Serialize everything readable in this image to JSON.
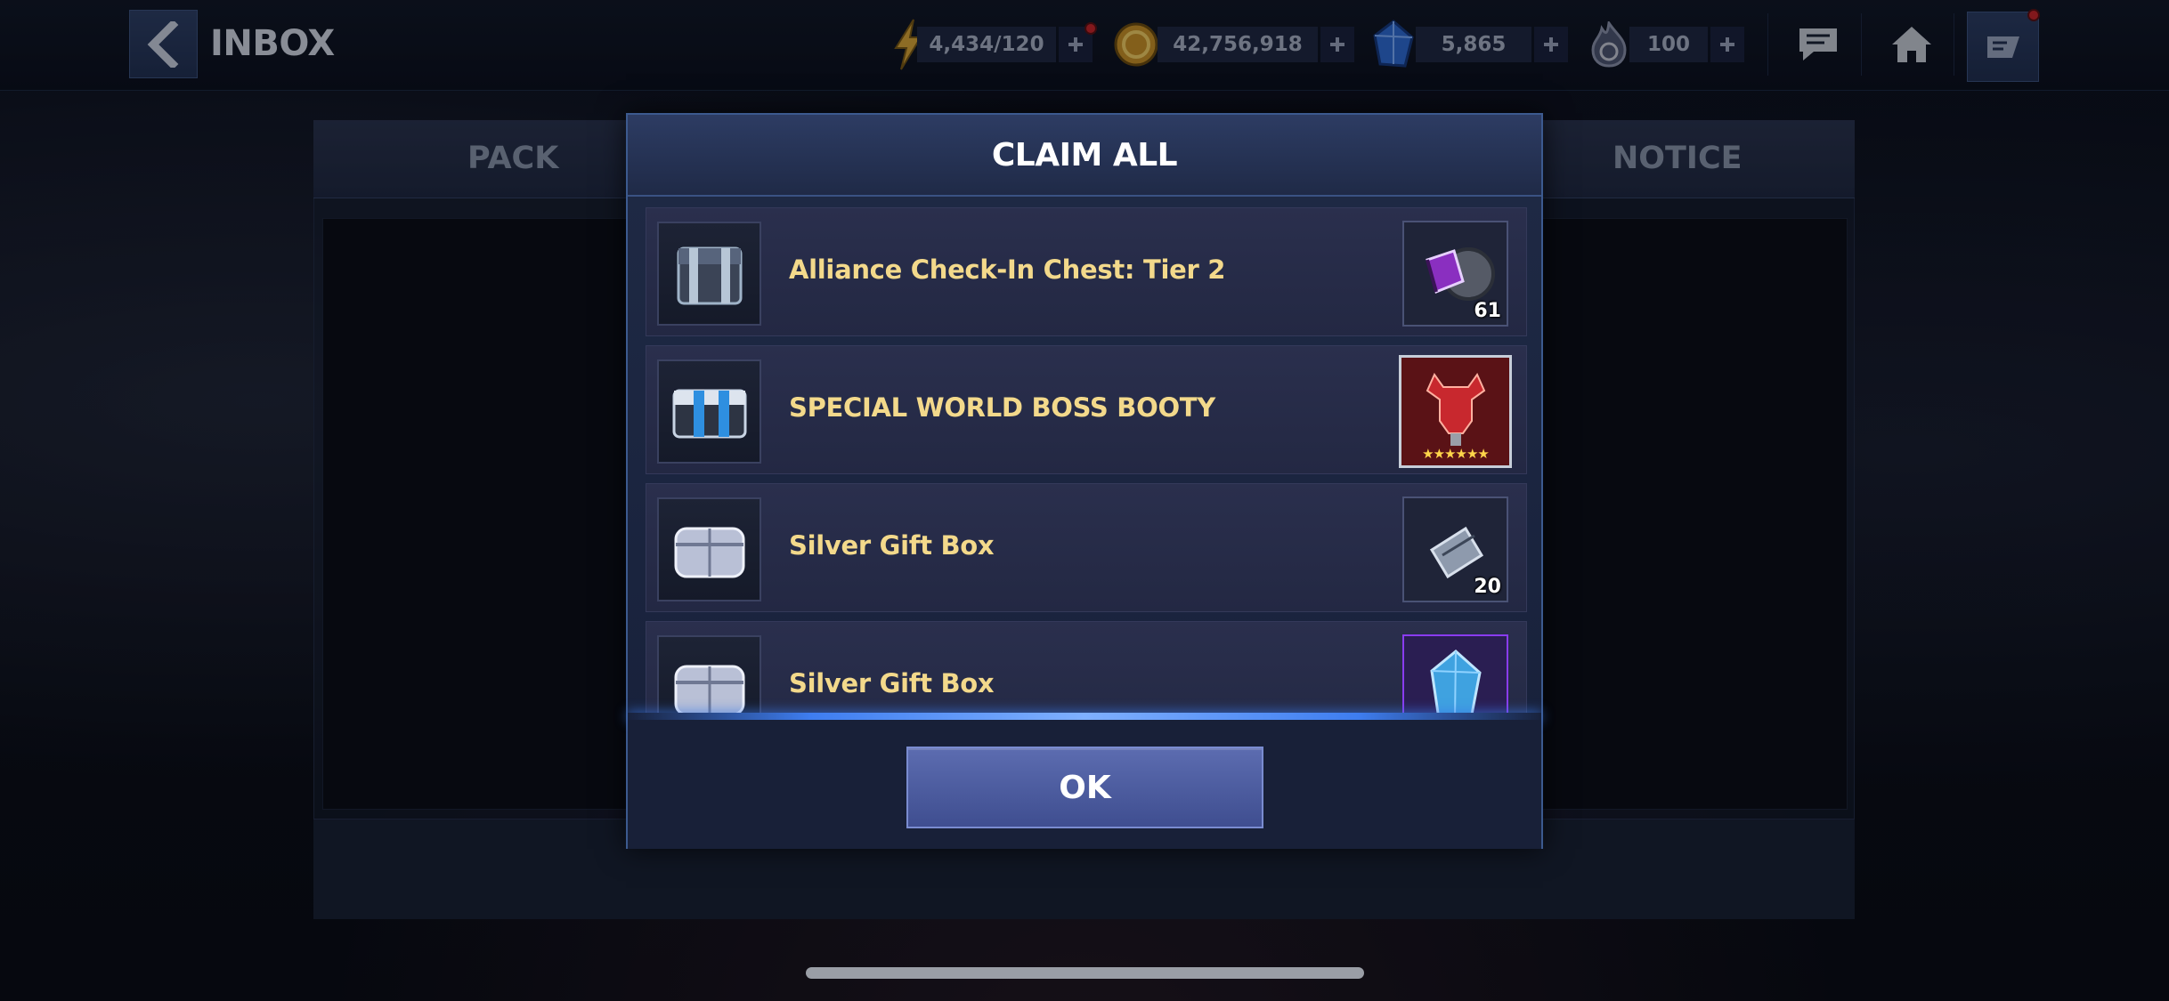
{
  "header": {
    "title": "INBOX"
  },
  "resources": {
    "energy": "4,434/120",
    "gold": "42,756,918",
    "crystals": "5,865",
    "stamina": "100"
  },
  "tabs": {
    "left": "PACK",
    "right": "NOTICE"
  },
  "modal": {
    "title": "CLAIM ALL",
    "ok_label": "OK",
    "items": [
      {
        "name": "Alliance Check-In Chest: Tier 2",
        "reward_count": "61",
        "thumb_icon": "dark-chest-icon",
        "reward_icon": "purple-gear-cube-icon"
      },
      {
        "name": "SPECIAL WORLD BOSS BOOTY",
        "reward_count": "",
        "reward_stars": "★★★★★★",
        "thumb_icon": "blue-chest-icon",
        "reward_icon": "red-gear-item-icon"
      },
      {
        "name": "Silver Gift Box",
        "reward_count": "20",
        "thumb_icon": "silver-gift-box-icon",
        "reward_icon": "ticket-icon"
      },
      {
        "name": "Silver Gift Box",
        "reward_count": "",
        "thumb_icon": "silver-gift-box-icon",
        "reward_icon": "blue-crystal-icon"
      }
    ]
  },
  "colors": {
    "item_label": "#f3d98b",
    "modal_border": "#3c5a8f",
    "ok_button": "#4f5ea3",
    "notification_dot": "#c8262c"
  }
}
